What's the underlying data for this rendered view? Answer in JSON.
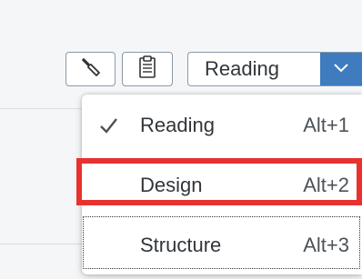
{
  "toolbar": {
    "wrench_icon": "wrench-icon",
    "clipboard_icon": "clipboard-icon",
    "mode_label": "Reading",
    "dropdown_icon": "chevron-down-icon",
    "accent_color": "#3e7bbf"
  },
  "menu": {
    "items": [
      {
        "label": "Reading",
        "shortcut": "Alt+1",
        "checked": true
      },
      {
        "label": "Design",
        "shortcut": "Alt+2",
        "checked": false
      },
      {
        "label": "Structure",
        "shortcut": "Alt+3",
        "checked": false
      }
    ],
    "highlight_color": "#e8322f"
  }
}
